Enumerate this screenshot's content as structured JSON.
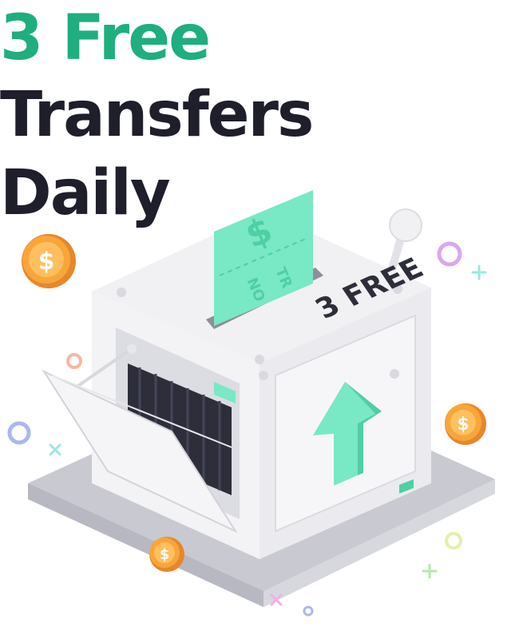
{
  "headline": {
    "number": "3",
    "accent": "Free",
    "rest": "Transfers",
    "line2": "Daily"
  },
  "illustration": {
    "badge_text": "3 FREE",
    "ticket_symbol": "$",
    "ticket_text_a": "TR",
    "ticket_text_b": "NO",
    "coin_symbol": "$",
    "colors": {
      "green_accent": "#1fae7f",
      "mint": "#79e8c4",
      "mint_dark": "#4fcfa4",
      "coin": "#f7a63a",
      "coin_dark": "#e8862a",
      "box_light": "#f3f3f6",
      "box_mid": "#e2e2e8",
      "box_shadow": "#c9c9d2",
      "dark_slots": "#2d2e3a"
    }
  }
}
